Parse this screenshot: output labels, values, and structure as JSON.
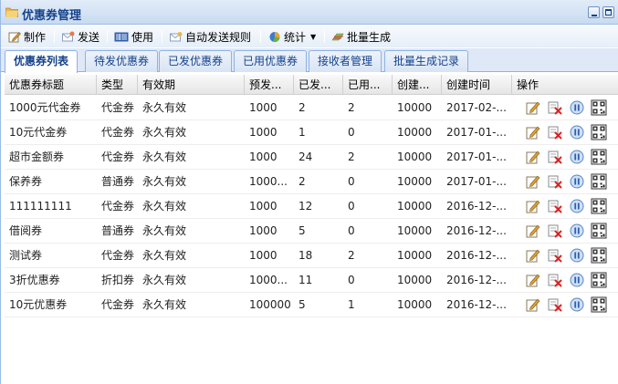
{
  "window": {
    "title": "优惠券管理",
    "controls": [
      "minimize",
      "maximize"
    ]
  },
  "toolbar": {
    "buttons": [
      {
        "label": "制作",
        "icon": "edit-icon"
      },
      {
        "label": "发送",
        "icon": "send-icon"
      },
      {
        "label": "使用",
        "icon": "barcode-icon"
      },
      {
        "label": "自动发送规则",
        "icon": "rule-icon"
      },
      {
        "label": "统计",
        "icon": "pie-chart-icon"
      },
      {
        "label": "批量生成",
        "icon": "batch-icon"
      }
    ]
  },
  "tabs": [
    {
      "label": "优惠券列表",
      "active": true
    },
    {
      "label": "待发优惠券",
      "active": false
    },
    {
      "label": "已发优惠券",
      "active": false
    },
    {
      "label": "已用优惠券",
      "active": false
    },
    {
      "label": "接收者管理",
      "active": false
    },
    {
      "label": "批量生成记录",
      "active": false
    }
  ],
  "grid": {
    "columns": [
      "优惠券标题",
      "类型",
      "有效期",
      "预发...",
      "已发...",
      "已用...",
      "创建...",
      "创建时间",
      "操作"
    ],
    "rows": [
      [
        "1000元代金券",
        "代金券",
        "永久有效",
        "1000",
        "2",
        "2",
        "10000",
        "2017-02-..."
      ],
      [
        "10元代金券",
        "代金券",
        "永久有效",
        "1000",
        "1",
        "0",
        "10000",
        "2017-01-..."
      ],
      [
        "超市金额券",
        "代金券",
        "永久有效",
        "1000",
        "24",
        "2",
        "10000",
        "2017-01-..."
      ],
      [
        "保养券",
        "普通券",
        "永久有效",
        "1000...",
        "2",
        "0",
        "10000",
        "2017-01-..."
      ],
      [
        "111111111",
        "代金券",
        "永久有效",
        "1000",
        "12",
        "0",
        "10000",
        "2016-12-..."
      ],
      [
        "借阅券",
        "普通券",
        "永久有效",
        "1000",
        "5",
        "0",
        "10000",
        "2016-12-..."
      ],
      [
        "测试券",
        "代金券",
        "永久有效",
        "1000",
        "18",
        "2",
        "10000",
        "2016-12-..."
      ],
      [
        "3折优惠券",
        "折扣券",
        "永久有效",
        "1000...",
        "11",
        "0",
        "10000",
        "2016-12-..."
      ],
      [
        "10元优惠券",
        "代金券",
        "永久有效",
        "100000",
        "5",
        "1",
        "10000",
        "2016-12-..."
      ]
    ],
    "row_actions": [
      "edit-icon",
      "delete-icon",
      "pause-icon",
      "qrcode-icon"
    ]
  },
  "colors": {
    "header_text": "#15428b",
    "panel_border": "#99bbe8",
    "tab_bg": "#dfe8f6"
  }
}
